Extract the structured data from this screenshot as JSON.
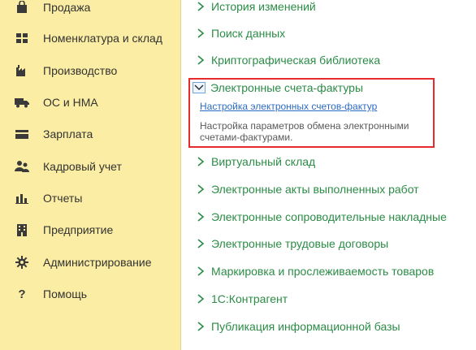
{
  "sidebar": {
    "items": [
      {
        "label": "Продажа",
        "icon": "sales-bag-icon"
      },
      {
        "label": "Номенклатура и склад",
        "icon": "grid-icon"
      },
      {
        "label": "Производство",
        "icon": "factory-icon"
      },
      {
        "label": "ОС и НМА",
        "icon": "truck-icon"
      },
      {
        "label": "Зарплата",
        "icon": "card-icon"
      },
      {
        "label": "Кадровый учет",
        "icon": "people-icon"
      },
      {
        "label": "Отчеты",
        "icon": "bar-chart-icon"
      },
      {
        "label": "Предприятие",
        "icon": "building-icon"
      },
      {
        "label": "Администрирование",
        "icon": "gear-icon"
      },
      {
        "label": "Помощь",
        "icon": "question-icon"
      }
    ]
  },
  "content": {
    "links_top": [
      {
        "label": "История изменений"
      },
      {
        "label": "Поиск данных"
      },
      {
        "label": "Криптографическая библиотека"
      }
    ],
    "expanded": {
      "label": "Электронные счета-фактуры",
      "sublink": "Настройка электронных счетов-фактур",
      "description": "Настройка параметров обмена электронными счетами-фактурами."
    },
    "links_bottom": [
      {
        "label": "Виртуальный склад"
      },
      {
        "label": "Электронные акты выполненных работ"
      },
      {
        "label": "Электронные сопроводительные накладные"
      },
      {
        "label": "Электронные трудовые договоры"
      },
      {
        "label": "Маркировка и прослеживаемость товаров"
      },
      {
        "label": "1С:Контрагент"
      },
      {
        "label": "Публикация информационной базы"
      }
    ]
  },
  "colors": {
    "sidebar_bg": "#fbeda3",
    "link_green": "#2b8c46",
    "sublink_blue": "#2d6cc4",
    "highlight_red": "#e52b2b"
  }
}
